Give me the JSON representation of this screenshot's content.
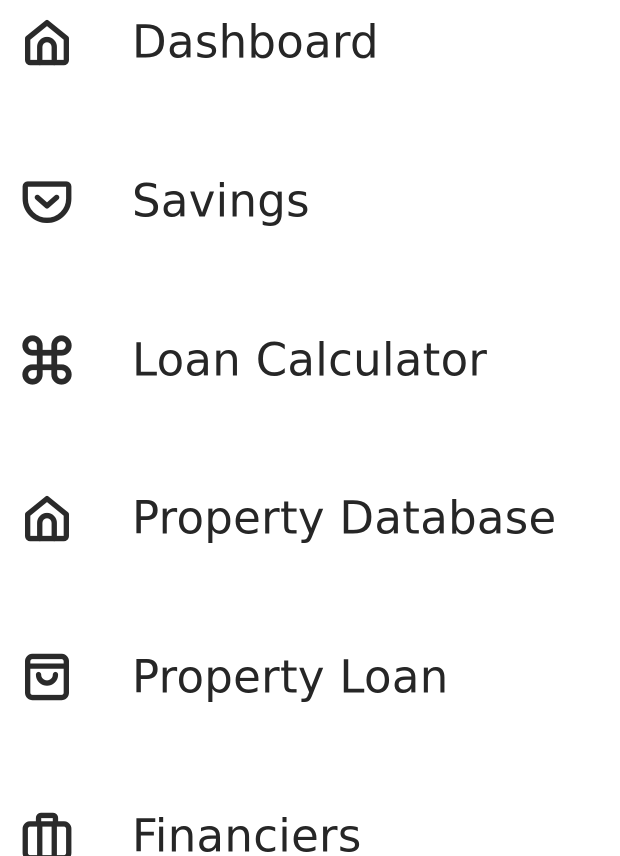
{
  "sidebar": {
    "items": [
      {
        "label": "Dashboard",
        "icon": "home-icon"
      },
      {
        "label": "Savings",
        "icon": "pocket-icon"
      },
      {
        "label": "Loan Calculator",
        "icon": "command-icon"
      },
      {
        "label": "Property Database",
        "icon": "home-icon"
      },
      {
        "label": "Property Loan",
        "icon": "shopping-bag-icon"
      },
      {
        "label": "Financiers",
        "icon": "briefcase-icon"
      }
    ]
  },
  "colors": {
    "text": "#262626",
    "icon_stroke": "#2a2a2a",
    "background": "#ffffff"
  }
}
